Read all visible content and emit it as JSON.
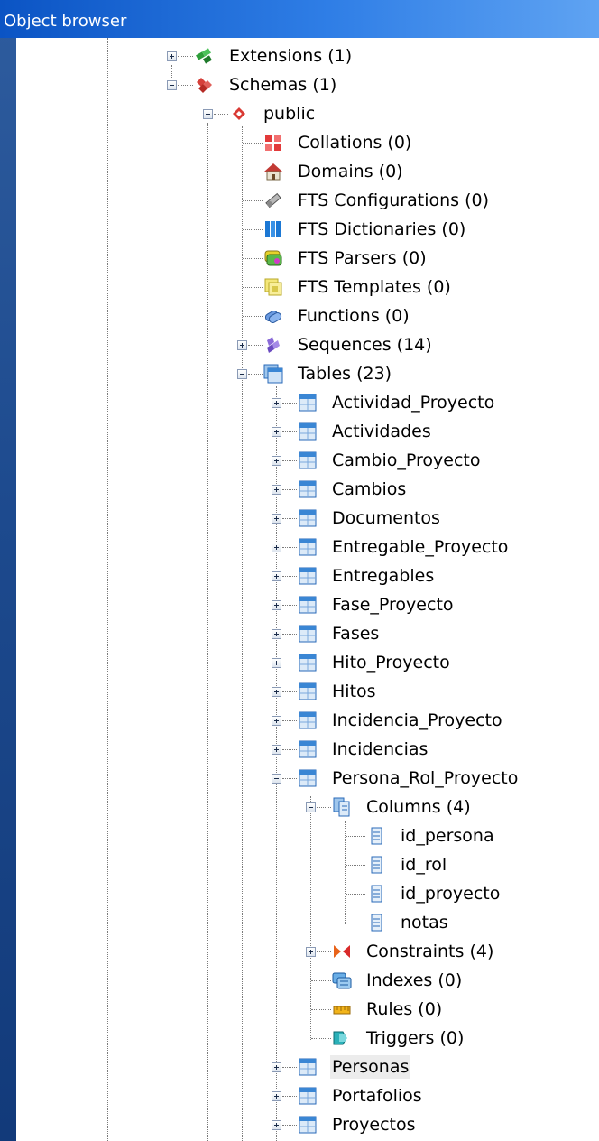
{
  "window": {
    "title": "Object browser"
  },
  "tree": {
    "extensions": "Extensions (1)",
    "schemas": "Schemas (1)",
    "public": "public",
    "collations": "Collations (0)",
    "domains": "Domains (0)",
    "fts_configurations": "FTS Configurations (0)",
    "fts_dictionaries": "FTS Dictionaries (0)",
    "fts_parsers": "FTS Parsers (0)",
    "fts_templates": "FTS Templates (0)",
    "functions": "Functions (0)",
    "sequences": "Sequences (14)",
    "tables": "Tables (23)",
    "table_items": [
      "Actividad_Proyecto",
      "Actividades",
      "Cambio_Proyecto",
      "Cambios",
      "Documentos",
      "Entregable_Proyecto",
      "Entregables",
      "Fase_Proyecto",
      "Fases",
      "Hito_Proyecto",
      "Hitos",
      "Incidencia_Proyecto",
      "Incidencias",
      "Persona_Rol_Proyecto"
    ],
    "columns": "Columns (4)",
    "column_items": [
      "id_persona",
      "id_rol",
      "id_proyecto",
      "notas"
    ],
    "constraints": "Constraints (4)",
    "indexes": "Indexes (0)",
    "rules": "Rules (0)",
    "triggers": "Triggers (0)",
    "tables_after": [
      "Personas",
      "Portafolios",
      "Proyectos"
    ]
  }
}
